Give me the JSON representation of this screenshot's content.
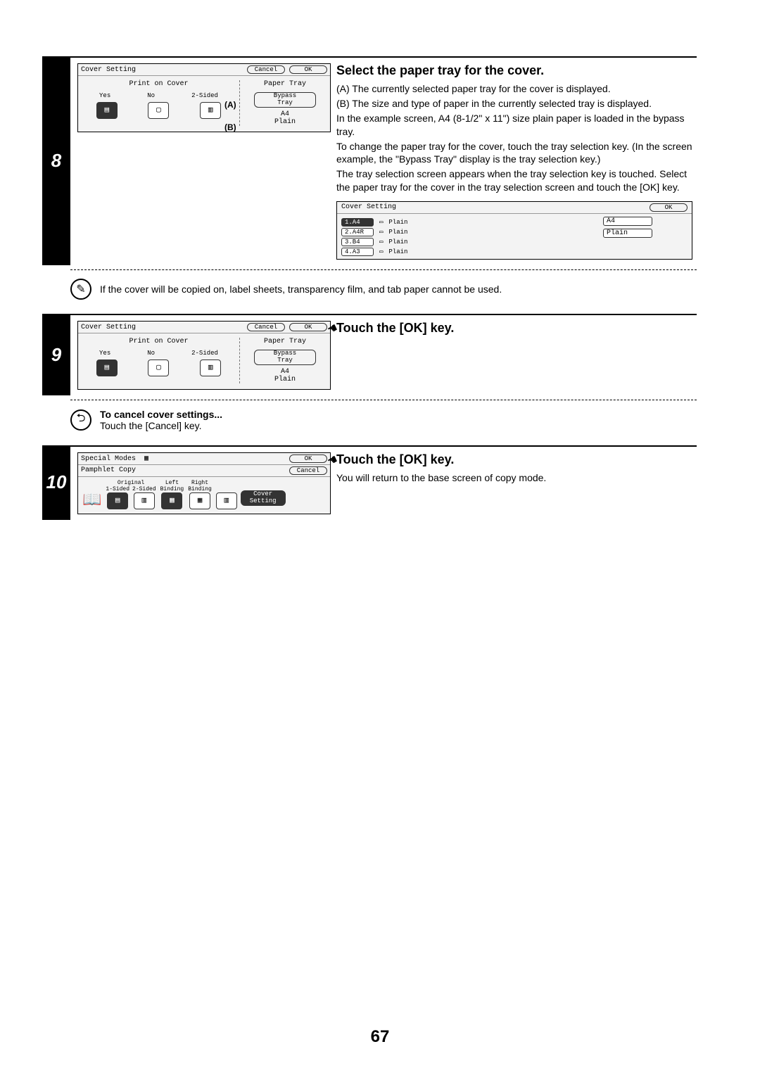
{
  "page_number": "67",
  "step8": {
    "num": "8",
    "heading": "Select the paper tray for the cover.",
    "pA": "(A) The currently selected paper tray for the cover is displayed.",
    "pB": "(B) The size and type of paper in the currently selected tray is displayed.",
    "p1": "In the example screen, A4 (8-1/2\" x 11\") size plain paper is loaded in the bypass tray.",
    "p2": "To change the paper tray for the cover, touch the tray selection key. (In the screen example, the \"Bypass Tray\" display is the tray selection key.)",
    "p3": "The tray selection screen appears when the tray selection key is touched. Select the paper tray for the cover in the tray selection screen and touch the [OK] key.",
    "lcd": {
      "title": "Cover Setting",
      "cancel": "Cancel",
      "ok": "OK",
      "print_on_cover": "Print on Cover",
      "paper_tray": "Paper Tray",
      "yes": "Yes",
      "no": "No",
      "two_sided": "2-Sided",
      "bypass1": "Bypass",
      "bypass2": "Tray",
      "a4": "A4",
      "plain": "Plain",
      "A": "(A)",
      "B": "(B)"
    },
    "tray": {
      "title": "Cover Setting",
      "ok": "OK",
      "r1_k": "1.A4",
      "r1_t": "Plain",
      "r2_k": "2.A4R",
      "r2_t": "Plain",
      "r3_k": "3.B4",
      "r3_t": "Plain",
      "r4_k": "4.A3",
      "r4_t": "Plain",
      "side_k": "A4",
      "side_t": "Plain"
    },
    "note": "If the cover will be copied on, label sheets, transparency film, and tab paper cannot be used."
  },
  "step9": {
    "num": "9",
    "heading": "Touch the [OK] key.",
    "lcd": {
      "title": "Cover Setting",
      "cancel": "Cancel",
      "ok": "OK",
      "print_on_cover": "Print on Cover",
      "paper_tray": "Paper Tray",
      "yes": "Yes",
      "no": "No",
      "two_sided": "2-Sided",
      "bypass1": "Bypass",
      "bypass2": "Tray",
      "a4": "A4",
      "plain": "Plain"
    },
    "cancel_head": "To cancel cover settings...",
    "cancel_text": "Touch the [Cancel] key."
  },
  "step10": {
    "num": "10",
    "heading": "Touch the [OK] key.",
    "text": "You will return to the base screen of copy mode.",
    "lcd": {
      "title": "Special Modes",
      "ok": "OK",
      "sub": "Pamphlet Copy",
      "cancel": "Cancel",
      "original": "Original",
      "one_sided": "1-Sided",
      "two_sided": "2-Sided",
      "left1": "Left",
      "left2": "Binding",
      "right1": "Right",
      "right2": "Binding",
      "cover1": "Cover",
      "cover2": "Setting"
    }
  }
}
